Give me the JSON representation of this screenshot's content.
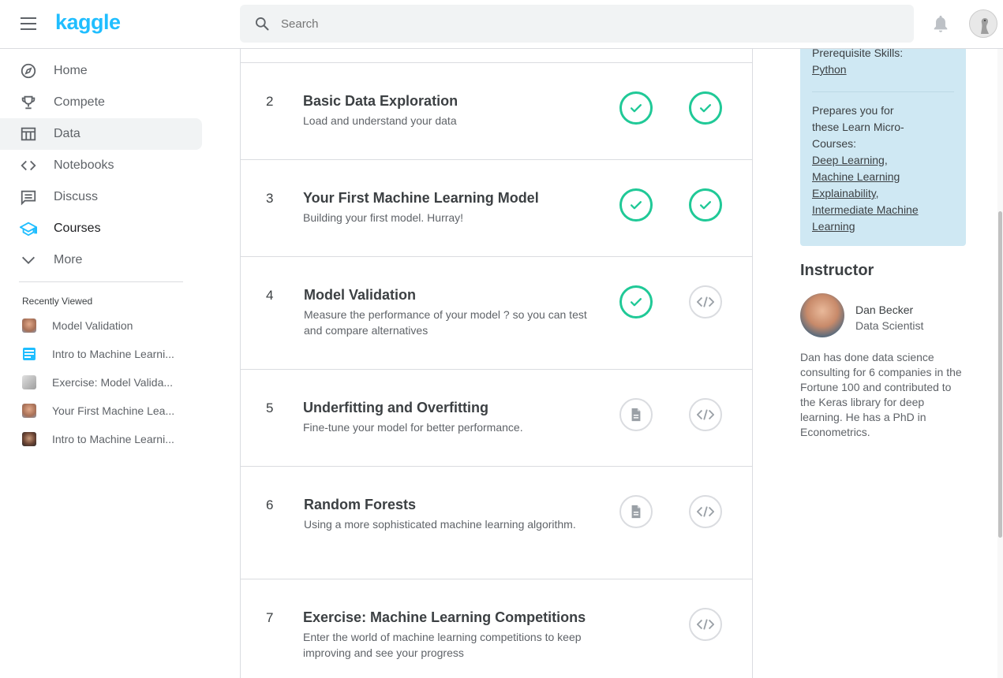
{
  "header": {
    "logo": "kaggle",
    "search_placeholder": "Search"
  },
  "sidebar": {
    "items": [
      {
        "label": "Home",
        "icon": "compass-icon"
      },
      {
        "label": "Compete",
        "icon": "trophy-icon"
      },
      {
        "label": "Data",
        "icon": "table-icon"
      },
      {
        "label": "Notebooks",
        "icon": "code-icon"
      },
      {
        "label": "Discuss",
        "icon": "comment-icon"
      },
      {
        "label": "Courses",
        "icon": "graduation-cap-icon"
      },
      {
        "label": "More",
        "icon": "chevron-down-icon"
      }
    ],
    "recently_viewed_title": "Recently Viewed",
    "recently_viewed": [
      "Model Validation",
      "Intro to Machine Learni...",
      "Exercise: Model Valida...",
      "Your First Machine Lea...",
      "Intro to Machine Learni..."
    ]
  },
  "lessons": [
    {
      "num": "2",
      "title": "Basic Data Exploration",
      "desc": "Load and understand your data",
      "tutorial": "done",
      "exercise": "done"
    },
    {
      "num": "3",
      "title": "Your First Machine Learning Model",
      "desc": "Building your first model. Hurray!",
      "tutorial": "done",
      "exercise": "done"
    },
    {
      "num": "4",
      "title": "Model Validation",
      "desc": "Measure the performance of your model ? so you can test and compare alternatives",
      "tutorial": "done",
      "exercise": "todo"
    },
    {
      "num": "5",
      "title": "Underfitting and Overfitting",
      "desc": "Fine-tune your model for better performance.",
      "tutorial": "todo",
      "exercise": "todo"
    },
    {
      "num": "6",
      "title": "Random Forests",
      "desc": "Using a more sophisticated machine learning algorithm.",
      "tutorial": "todo",
      "exercise": "todo"
    },
    {
      "num": "7",
      "title": "Exercise: Machine Learning Competitions",
      "desc": "Enter the world of machine learning competitions to keep improving and see your progress",
      "tutorial": "none",
      "exercise": "todo"
    }
  ],
  "right": {
    "prereq_label": "Prerequisite Skills:",
    "prereq_link": "Python",
    "prepares_line1": "Prepares you for",
    "prepares_line2": "these Learn Micro-",
    "prepares_line3": "Courses:",
    "link_deep": "Deep Learning",
    "link_mle1": "Machine Learning",
    "link_mle2": "Explainability",
    "link_iml1": "Intermediate Machine",
    "link_iml2": "Learning",
    "comma": ",",
    "instructor_title": "Instructor",
    "instructor_name": "Dan Becker",
    "instructor_role": "Data Scientist",
    "instructor_bio": "Dan has done data science consulting for 6 companies in the Fortune 100 and contributed to the Keras library for deep learning. He has a PhD in Econometrics."
  },
  "colors": {
    "accent": "#20beff",
    "done": "#20c997"
  }
}
